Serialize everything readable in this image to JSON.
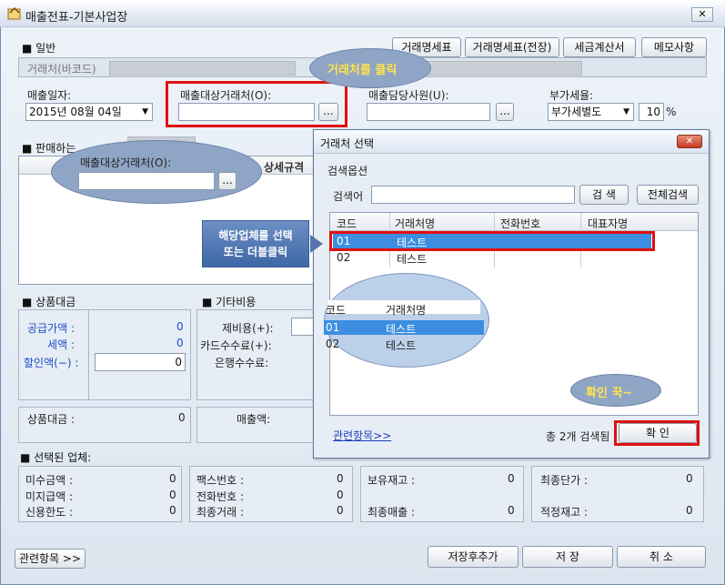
{
  "window": {
    "title": "매출전표-기본사업장",
    "close_glyph": "✕"
  },
  "general": {
    "section_label": "■ 일반",
    "buttons": [
      "거래명세표",
      "거래명세표(전장)",
      "세금계산서",
      "메모사항"
    ],
    "barcode_label": "거래처(바코드)",
    "sales_date_label": "매출일자:",
    "sales_date_value": "2015년 08월 04일",
    "customer_label": "매출대상거래처(O):",
    "staff_label": "매출담당사원(U):",
    "vat_label": "부가세율:",
    "vat_mode": "부가세별도",
    "vat_rate": "10",
    "percent": "%",
    "browse": "..."
  },
  "sales_items": {
    "section_label": "■ 판매하는",
    "col_spec": "상세규격"
  },
  "goods_total": {
    "section_label": "■ 상품대금",
    "supply_label": "공급가액 :",
    "tax_label": "세액 :",
    "discount_label": "할인액(−) :",
    "supply_value": "0",
    "tax_value": "0",
    "discount_value": "0",
    "total_label": "상품대금 :",
    "total_value": "0"
  },
  "other_costs": {
    "section_label": "■ 기타비용",
    "fee_label": "제비용(+):",
    "card_label": "카드수수료(+):",
    "bank_label": "은행수수료:",
    "sales_amount_label": "매출액:"
  },
  "selected_company": {
    "section_label": "■ 선택된 업체:",
    "rows": [
      {
        "label": "미수금액 :",
        "value": "0"
      },
      {
        "label": "미지급액 :",
        "value": "0"
      },
      {
        "label": "신용한도 :",
        "value": "0"
      }
    ],
    "rows2": [
      {
        "label": "팩스번호 :",
        "value": "0"
      },
      {
        "label": "전화번호 :",
        "value": "0"
      },
      {
        "label": "최종거래 :",
        "value": "0"
      }
    ],
    "rows3": [
      {
        "label": "보유재고 :",
        "value": "0"
      },
      {
        "label": "",
        "value": ""
      },
      {
        "label": "최종매출 :",
        "value": "0"
      }
    ],
    "rows4": [
      {
        "label": "최종단가 :",
        "value": "0"
      },
      {
        "label": "",
        "value": ""
      },
      {
        "label": "적정재고 :",
        "value": "0"
      }
    ]
  },
  "footer": {
    "related": "관련항목 >>",
    "save_add": "저장후추가",
    "save": "저 장",
    "cancel": "취 소"
  },
  "dialog": {
    "title": "거래처 선택",
    "search_options": "검색옵션",
    "keyword_label": "검색어",
    "search_btn": "검 색",
    "search_all_btn": "전체검색",
    "columns": [
      "코드",
      "거래처명",
      "전화번호",
      "대표자명"
    ],
    "rows": [
      {
        "code": "01",
        "name": "테스트",
        "phone": "",
        "rep": ""
      },
      {
        "code": "02",
        "name": "테스트",
        "phone": "",
        "rep": ""
      }
    ],
    "related_link": "관련항목>>",
    "count_text": "총 2개 검색됨",
    "ok_btn": "확 인"
  },
  "annotations": {
    "click_customer": "거래처를 클릭",
    "select_company": "해당업체를 선택\n또는 더블클릭",
    "confirm": "확인 꾹~",
    "zoom_customer_label": "매출대상거래처(O):",
    "zoom_columns": [
      "코드",
      "거래처명"
    ],
    "zoom_rows": [
      {
        "code": "01",
        "name": "테스트"
      },
      {
        "code": "02",
        "name": "테스트"
      }
    ]
  }
}
